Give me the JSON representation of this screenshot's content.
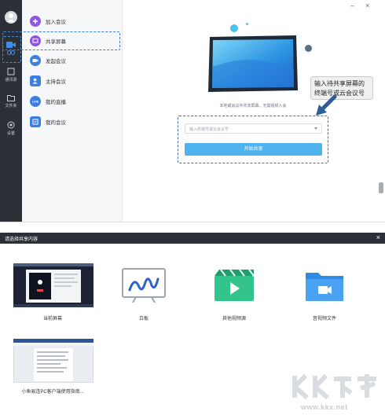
{
  "top_window": {
    "rail": {
      "items": [
        {
          "label": ""
        },
        {
          "label": "通讯录"
        },
        {
          "label": "文件夹"
        },
        {
          "label": "设置"
        }
      ]
    },
    "menu": {
      "items": [
        {
          "label": "加入会议",
          "icon": "plus-circle-icon",
          "color": "#8e57e0"
        },
        {
          "label": "共享屏幕",
          "icon": "screen-share-icon",
          "color": "#8e57e0"
        },
        {
          "label": "发起会议",
          "icon": "video-camera-icon",
          "color": "#3d7ee0"
        },
        {
          "label": "主持会议",
          "icon": "host-icon",
          "color": "#3d7ee0"
        },
        {
          "label": "我的直播",
          "icon": "live-icon",
          "color": "#3d7ee0"
        },
        {
          "label": "我的会议",
          "icon": "calendar-icon",
          "color": "#3d7ee0"
        }
      ]
    },
    "main": {
      "hint": "本地或会议中共享屏幕，无需视频入会",
      "input_placeholder": "输入终端号或云会议号",
      "start_button": "开始共享",
      "callout_line1": "输入待共享屏幕的",
      "callout_line2": "终端号或云会议号"
    },
    "controls": {
      "minimize": "–",
      "close": "×"
    }
  },
  "dialog": {
    "title": "请选择共享内容",
    "close": "×",
    "tiles": [
      {
        "label": "当前屏幕",
        "icon": "desktop-screenshot-icon"
      },
      {
        "label": "白板",
        "icon": "whiteboard-icon"
      },
      {
        "label": "其他视频源",
        "icon": "video-source-icon"
      },
      {
        "label": "音视频文件",
        "icon": "media-folder-icon"
      },
      {
        "label": "小鱼易连PC客户端使用指南...",
        "icon": "document-window-icon"
      }
    ]
  },
  "watermark": {
    "brand": "KK下载",
    "url": "www.kkx.net"
  },
  "colors": {
    "accent": "#4fb3ef",
    "dark": "#2b2f36",
    "dashed": "#3f6fb0",
    "purple": "#8e57e0"
  }
}
